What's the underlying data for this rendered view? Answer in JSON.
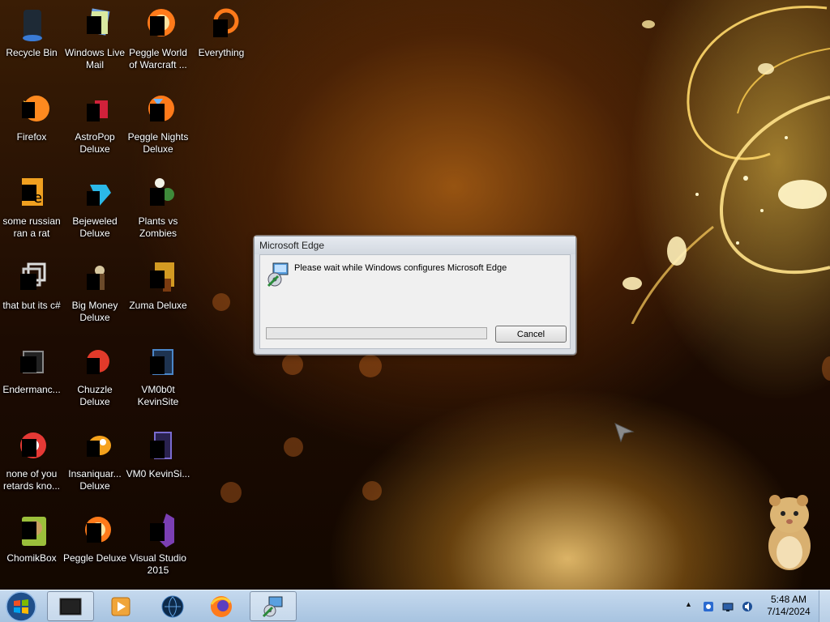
{
  "desktop": {
    "icons": [
      {
        "label": "Recycle Bin",
        "icon": "recycle-bin-icon"
      },
      {
        "label": "Windows Live Mail",
        "icon": "mail-icon"
      },
      {
        "label": "Peggle World of Warcraft ...",
        "icon": "peggle-icon"
      },
      {
        "label": "Everything",
        "icon": "search-icon"
      },
      {
        "label": "Firefox",
        "icon": "firefox-icon"
      },
      {
        "label": "AstroPop Deluxe",
        "icon": "game-icon"
      },
      {
        "label": "Peggle Nights Deluxe",
        "icon": "peggle-icon"
      },
      {
        "label": "some russian ran a rat",
        "icon": "file-icon"
      },
      {
        "label": "Bejeweled Deluxe",
        "icon": "gem-icon"
      },
      {
        "label": "Plants vs Zombies",
        "icon": "plant-icon"
      },
      {
        "label": "that but its c#",
        "icon": "folder-shortcut-icon"
      },
      {
        "label": "Big Money Deluxe",
        "icon": "game-icon"
      },
      {
        "label": "Zuma Deluxe",
        "icon": "game-icon"
      },
      {
        "label": "Endermanc...",
        "icon": "app-icon"
      },
      {
        "label": "Chuzzle Deluxe",
        "icon": "game-icon"
      },
      {
        "label": "VM0b0t KevinSite",
        "icon": "app-icon"
      },
      {
        "label": "none of you retards kno...",
        "icon": "chrome-icon"
      },
      {
        "label": "Insaniquar... Deluxe",
        "icon": "fish-icon"
      },
      {
        "label": "VM0 KevinSi...",
        "icon": "app-icon"
      },
      {
        "label": "ChomikBox",
        "icon": "hamster-icon"
      },
      {
        "label": "Peggle Deluxe",
        "icon": "peggle-icon"
      },
      {
        "label": "Visual Studio 2015",
        "icon": "visual-studio-icon"
      }
    ]
  },
  "dialog": {
    "title": "Microsoft Edge",
    "message": "Please wait while Windows configures Microsoft Edge",
    "cancel_label": "Cancel",
    "progress": 0
  },
  "taskbar": {
    "pinned": [
      "terminal-icon",
      "media-player-icon",
      "globe-icon",
      "firefox-icon",
      "installer-icon"
    ],
    "clock": {
      "time": "5:48 AM",
      "date": "7/14/2024"
    }
  },
  "colors": {
    "taskbar": "#b7cfe8",
    "dialog_bg": "#f0f0f0",
    "accent_glow": "#ffcc55"
  }
}
